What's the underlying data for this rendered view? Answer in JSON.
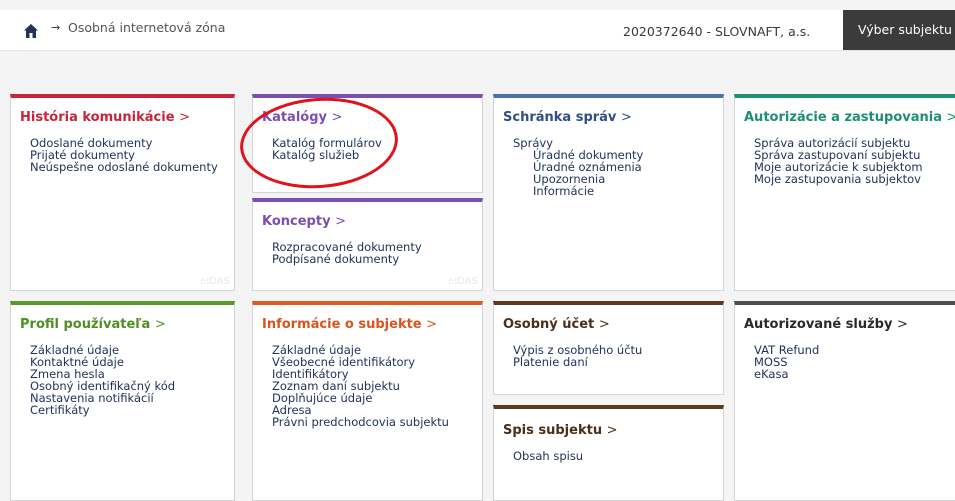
{
  "header": {
    "breadcrumb_arrow": "→",
    "breadcrumb": "Osobná internetová zóna",
    "subject": "2020372640 - SLOVNAFT, a.s.",
    "select_button": "Výber subjektu"
  },
  "cards": {
    "historia": {
      "title": "História komunikácie",
      "links": [
        "Odoslané dokumenty",
        "Prijaté dokumenty",
        "Neúspešne odoslané dokumenty"
      ],
      "footer": "eIDAS"
    },
    "katalogy": {
      "title": "Katalógy",
      "links": [
        "Katalóg formulárov",
        "Katalóg služieb"
      ]
    },
    "koncepty": {
      "title": "Koncepty",
      "links": [
        "Rozpracované dokumenty",
        "Podpísané dokumenty"
      ],
      "footer": "eIDAS"
    },
    "schranka": {
      "title": "Schránka správ",
      "group_label": "Správy",
      "links": [
        "Úradné dokumenty",
        "Úradné oznámenia",
        "Upozornenia",
        "Informácie"
      ]
    },
    "autorizacie": {
      "title": "Autorizácie a zastupovania",
      "links": [
        "Správa autorizácií subjektu",
        "Správa zastupovaní subjektu",
        "Moje autorizácie k subjektom",
        "Moje zastupovania subjektov"
      ]
    },
    "profil": {
      "title": "Profil používateľa",
      "links": [
        "Základné údaje",
        "Kontaktné údaje",
        "Zmena hesla",
        "Osobný identifikačný kód",
        "Nastavenia notifikácií",
        "Certifikáty"
      ]
    },
    "informacie": {
      "title": "Informácie o subjekte",
      "links": [
        "Základné údaje",
        "Všeobecné identifikátory",
        "Identifikátory",
        "Zoznam daní subjektu",
        "Doplňujúce údaje",
        "Adresa",
        "Právni predchodcovia subjektu"
      ]
    },
    "ucet": {
      "title": "Osobný účet",
      "links": [
        "Výpis z osobného účtu",
        "Platenie daní"
      ]
    },
    "spis": {
      "title": "Spis subjektu",
      "links": [
        "Obsah spisu"
      ]
    },
    "sluzby": {
      "title": "Autorizované služby",
      "links": [
        "VAT Refund",
        "MOSS",
        "eKasa"
      ]
    }
  },
  "title_suffix": ">",
  "colors": {
    "red": "#c8253a",
    "purple": "#7b4eb6",
    "blue": "#4e6fa6",
    "teal": "#1d8f73",
    "green": "#5a9a2a",
    "orange": "#e25a22",
    "brown": "#5b3a22",
    "gray": "#4f4f4f",
    "annotation": "#e0131a"
  },
  "icons": {
    "home": "home-icon"
  }
}
